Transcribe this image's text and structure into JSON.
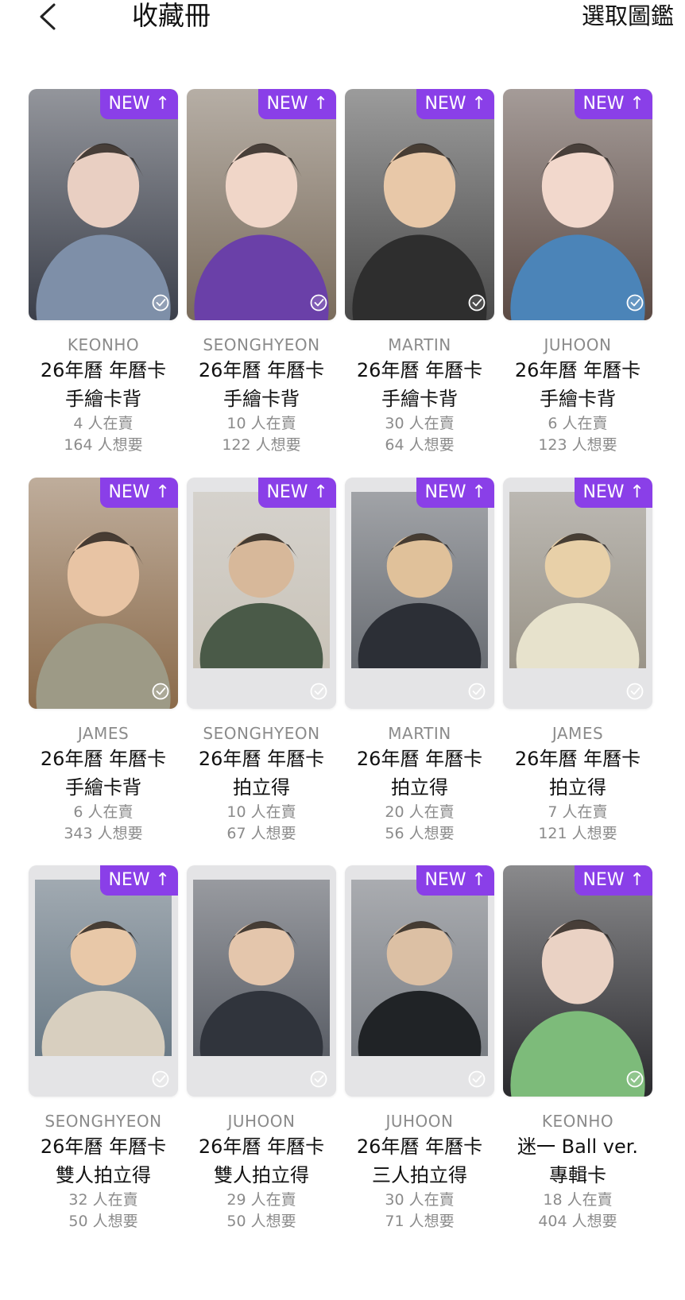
{
  "header": {
    "title": "收藏冊",
    "select_label": "選取圖鑑"
  },
  "colors": {
    "accent": "#8a3fe8",
    "muted": "#8b8b8b",
    "text": "#111111"
  },
  "cards": [
    {
      "member": "KEONHO",
      "name_line1": "26年曆 年曆卡",
      "name_line2": "手繪卡背",
      "selling": "4 人在賣",
      "wanting": "164 人想要",
      "new": "NEW ↑",
      "style": "full"
    },
    {
      "member": "SEONGHYEON",
      "name_line1": "26年曆 年曆卡",
      "name_line2": "手繪卡背",
      "selling": "10 人在賣",
      "wanting": "122 人想要",
      "new": "NEW ↑",
      "style": "full"
    },
    {
      "member": "MARTIN",
      "name_line1": "26年曆 年曆卡",
      "name_line2": "手繪卡背",
      "selling": "30 人在賣",
      "wanting": "64 人想要",
      "new": "NEW ↑",
      "style": "full"
    },
    {
      "member": "JUHOON",
      "name_line1": "26年曆 年曆卡",
      "name_line2": "手繪卡背",
      "selling": "6 人在賣",
      "wanting": "123 人想要",
      "new": "NEW ↑",
      "style": "full"
    },
    {
      "member": "JAMES",
      "name_line1": "26年曆 年曆卡",
      "name_line2": "手繪卡背",
      "selling": "6 人在賣",
      "wanting": "343 人想要",
      "new": "NEW ↑",
      "style": "full"
    },
    {
      "member": "SEONGHYEON",
      "name_line1": "26年曆 年曆卡",
      "name_line2": "拍立得",
      "selling": "10 人在賣",
      "wanting": "67 人想要",
      "new": "NEW ↑",
      "style": "polaroid"
    },
    {
      "member": "MARTIN",
      "name_line1": "26年曆 年曆卡",
      "name_line2": "拍立得",
      "selling": "20 人在賣",
      "wanting": "56 人想要",
      "new": "NEW ↑",
      "style": "polaroid"
    },
    {
      "member": "JAMES",
      "name_line1": "26年曆 年曆卡",
      "name_line2": "拍立得",
      "selling": "7 人在賣",
      "wanting": "121 人想要",
      "new": "NEW ↑",
      "style": "polaroid"
    },
    {
      "member": "SEONGHYEON",
      "name_line1": "26年曆 年曆卡",
      "name_line2": "雙人拍立得",
      "selling": "32 人在賣",
      "wanting": "50 人想要",
      "new": "NEW ↑",
      "style": "polaroid"
    },
    {
      "member": "JUHOON",
      "name_line1": "26年曆 年曆卡",
      "name_line2": "雙人拍立得",
      "selling": "29 人在賣",
      "wanting": "50 人想要",
      "new": "",
      "style": "polaroid"
    },
    {
      "member": "JUHOON",
      "name_line1": "26年曆 年曆卡",
      "name_line2": "三人拍立得",
      "selling": "30 人在賣",
      "wanting": "71 人想要",
      "new": "NEW ↑",
      "style": "polaroid"
    },
    {
      "member": "KEONHO",
      "name_line1": "迷一 Ball ver.",
      "name_line2": "專輯卡",
      "selling": "18 人在賣",
      "wanting": "404 人想要",
      "new": "NEW ↑",
      "style": "full"
    }
  ]
}
